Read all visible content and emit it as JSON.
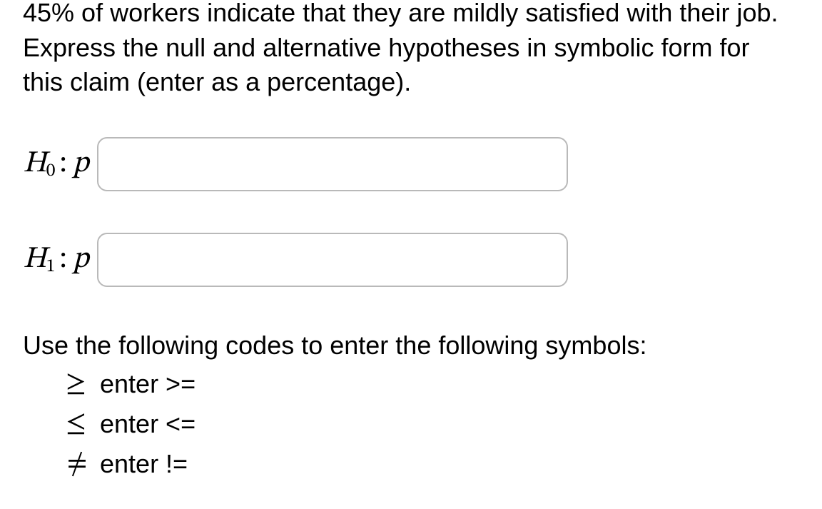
{
  "question": "45% of workers indicate that they are mildly satisfied with their job. Express the null and alternative hypotheses in symbolic form for this claim (enter as a percentage).",
  "hypotheses": {
    "h0": {
      "label_H": "H",
      "label_sub": "0",
      "label_colon": ":",
      "label_p": "p",
      "value": ""
    },
    "h1": {
      "label_H": "H",
      "label_sub": "1",
      "label_colon": ":",
      "label_p": "p",
      "value": ""
    }
  },
  "codes": {
    "intro": "Use the following codes to enter the following symbols:",
    "rows": [
      {
        "symbol": "≥",
        "text": "enter >="
      },
      {
        "symbol": "≤",
        "text": "enter <="
      },
      {
        "symbol": "≠",
        "text": "enter !="
      }
    ]
  }
}
